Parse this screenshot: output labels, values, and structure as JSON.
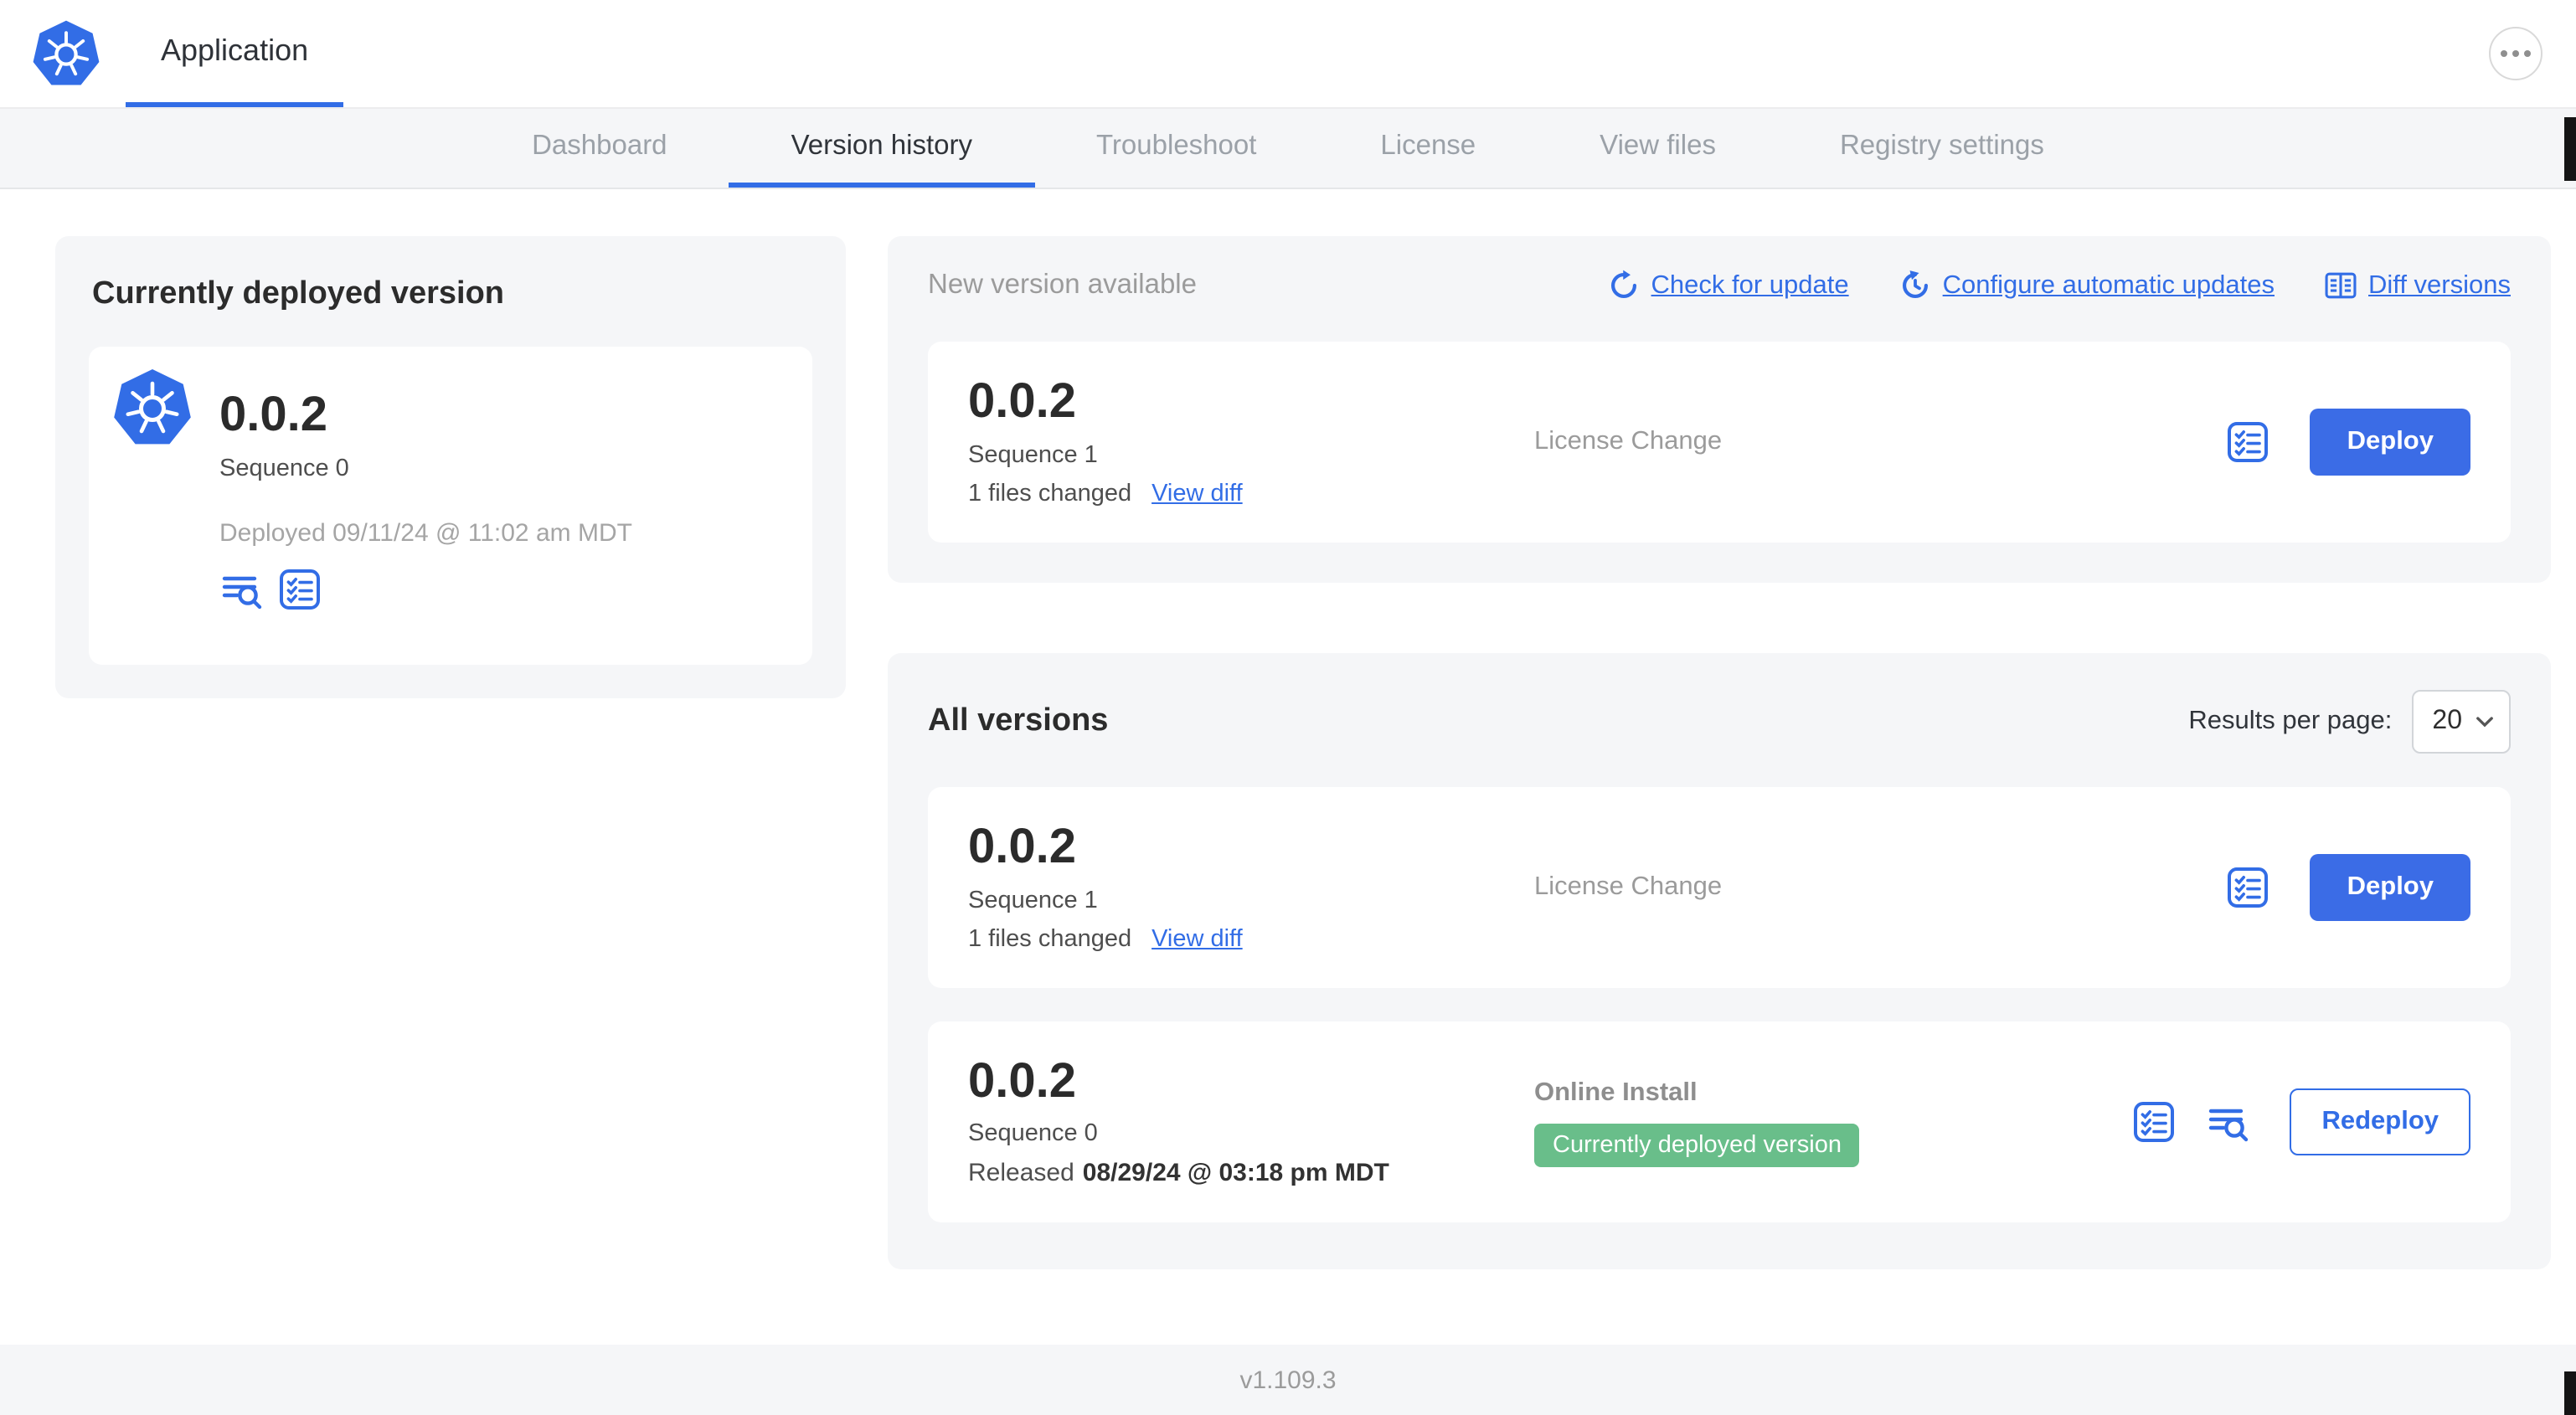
{
  "header": {
    "app_tab": "Application"
  },
  "nav": {
    "items": [
      {
        "label": "Dashboard"
      },
      {
        "label": "Version history"
      },
      {
        "label": "Troubleshoot"
      },
      {
        "label": "License"
      },
      {
        "label": "View files"
      },
      {
        "label": "Registry settings"
      }
    ]
  },
  "deployed": {
    "title": "Currently deployed version",
    "version": "0.0.2",
    "sequence": "Sequence 0",
    "deployed_at": "Deployed 09/11/24 @ 11:02 am MDT"
  },
  "new_version": {
    "title": "New version available",
    "actions": {
      "check": "Check for update",
      "configure": "Configure automatic updates",
      "diff": "Diff versions"
    },
    "card": {
      "version": "0.0.2",
      "sequence": "Sequence 1",
      "files_changed": "1 files changed",
      "view_diff": "View diff",
      "source": "License Change",
      "deploy": "Deploy"
    }
  },
  "all_versions": {
    "title": "All versions",
    "results_per_page_label": "Results per page:",
    "results_per_page_value": "20",
    "rows": [
      {
        "version": "0.0.2",
        "sequence": "Sequence 1",
        "files_changed": "1 files changed",
        "view_diff": "View diff",
        "source": "License Change",
        "action": "Deploy"
      },
      {
        "version": "0.0.2",
        "sequence": "Sequence 0",
        "released_prefix": "Released",
        "released_date": "08/29/24 @ 03:18 pm MDT",
        "source": "Online Install",
        "badge": "Currently deployed version",
        "action": "Redeploy"
      }
    ]
  },
  "footer": {
    "app_version": "v1.109.3"
  },
  "colors": {
    "accent_blue": "#326de6",
    "deploy_button_blue": "#3b6ce6",
    "badge_green": "#69be8a",
    "panel_bg": "#f5f6f8",
    "muted_text": "#9b9b9b"
  }
}
